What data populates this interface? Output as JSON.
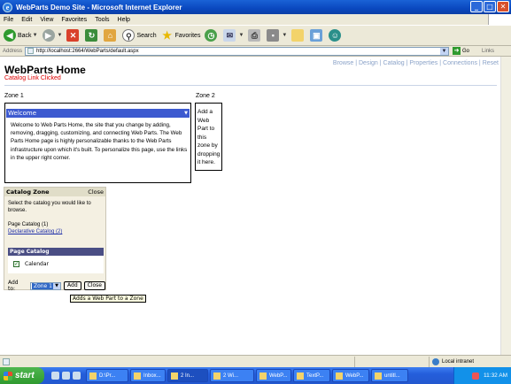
{
  "window": {
    "title": "WebParts Demo Site - Microsoft Internet Explorer",
    "ie_glyph": "e",
    "controls": [
      "_",
      "□",
      "✕"
    ]
  },
  "menu": [
    "File",
    "Edit",
    "View",
    "Favorites",
    "Tools",
    "Help"
  ],
  "toolbar": {
    "back": "Back",
    "search": "Search",
    "favorites": "Favorites"
  },
  "address": {
    "label": "Address",
    "url": "http://localhost:2664/WebParts/default.aspx",
    "go": "Go",
    "links": "Links"
  },
  "page": {
    "title": "WebParts Home",
    "status_message": "Catalog Link Clicked",
    "modes": [
      "Browse",
      "Design",
      "Catalog",
      "Properties",
      "Connections",
      "Reset"
    ],
    "mode_separator": "|",
    "zone1": {
      "label": "Zone 1",
      "part_title": "Welcome",
      "part_menu_glyph": "▼",
      "part_text": "Welcome to Web Parts Home, the site that you change by adding, removing, dragging, customizing, and connecting Web Parts. The Web Parts Home page is highly personalizable thanks to the Web Parts infrastructure upon which it's built. To personalize this page, use the links in the upper right corner."
    },
    "zone2": {
      "label": "Zone 2",
      "text": "Add a Web Part to this zone by dropping it here."
    },
    "catalog_zone": {
      "title": "Catalog Zone",
      "close_link": "Close",
      "instruction": "Select the catalog you would like to browse.",
      "catalogs": [
        "Page Catalog (1)",
        "Declarative Catalog (2)"
      ],
      "page_catalog_header": "Page Catalog",
      "items": [
        {
          "label": "Calendar",
          "checked": true
        }
      ],
      "add_to_label": "Add to:",
      "zone_select": "Zone 1",
      "add_button": "Add",
      "close_button": "Close",
      "tooltip": "Adds a Web Part to a Zone"
    }
  },
  "statusbar": {
    "zone": "Local intranet"
  },
  "taskbar": {
    "start": "start",
    "tasks": [
      "D:\\Pr...",
      "Inbox...",
      "2 In...",
      "2 Wi...",
      "WebP...",
      "TextP...",
      "WebP...",
      "untitl..."
    ],
    "clock": "11:32 AM"
  },
  "colors": {
    "title_bar": "#0a48bf",
    "part_header": "#3d5ad0",
    "status_red": "#dd0000",
    "link_blue": "#1b2ca8"
  }
}
